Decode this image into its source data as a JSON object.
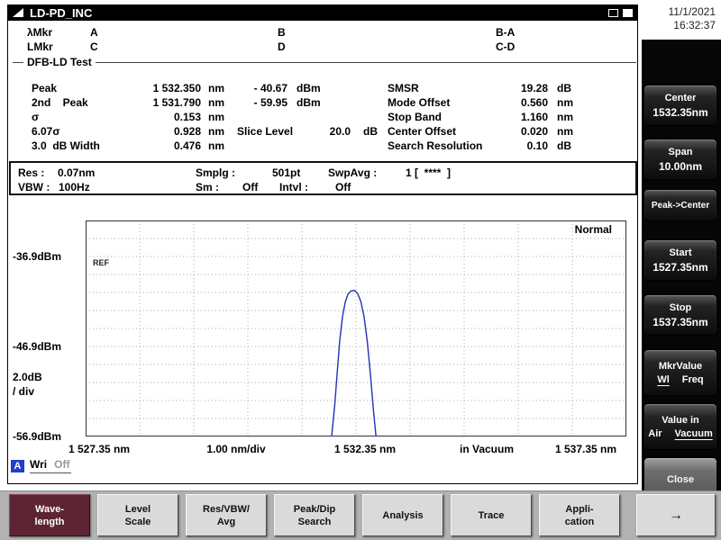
{
  "window": {
    "title": "LD-PD_INC"
  },
  "icons": {
    "app_logo_icon": "right-triangle",
    "window_restore_icon": "outlined-square",
    "window_maximize_icon": "filled-square",
    "more_arrow_icon": "→"
  },
  "clock": {
    "date": "11/1/2021",
    "time": "16:32:37"
  },
  "markers": {
    "row1": {
      "name": "λMkr",
      "c1": "A",
      "c2": "B",
      "c3": "B-A"
    },
    "row2": {
      "name": "LMkr",
      "c1": "C",
      "c2": "D",
      "c3": "C-D"
    }
  },
  "analysis": {
    "title": "DFB-LD Test",
    "left_rows": [
      {
        "label": "Peak",
        "num": "1 532.350",
        "unit": "nm",
        "level_num": "- 40.67",
        "level_unit": "dBm"
      },
      {
        "label": "2nd    Peak",
        "num": "1 531.790",
        "unit": "nm",
        "level_num": "- 59.95",
        "level_unit": "dBm"
      },
      {
        "label": "σ",
        "num": "0.153",
        "unit": "nm"
      },
      {
        "label": "6.07σ",
        "num": "0.928",
        "unit": "nm",
        "extra_label": "Slice Level",
        "extra_num": "20.0",
        "extra_unit": "dB"
      },
      {
        "label": "3.0  dB Width",
        "num": "0.476",
        "unit": "nm"
      }
    ],
    "right_rows": [
      {
        "label": "SMSR",
        "num": "19.28",
        "unit": "dB"
      },
      {
        "label": "Mode Offset",
        "num": "0.560",
        "unit": "nm"
      },
      {
        "label": "Stop Band",
        "num": "1.160",
        "unit": "nm"
      },
      {
        "label": "Center Offset",
        "num": "0.020",
        "unit": "nm"
      },
      {
        "label": "Search Resolution",
        "num": "0.10",
        "unit": "dB"
      }
    ]
  },
  "sweep": {
    "res_label": "Res :",
    "res_value": "0.07nm",
    "smplg_label": "Smplg :",
    "smplg_value": "501pt",
    "swpavg_label": "SwpAvg :",
    "swpavg_value": "1 [  ****  ]",
    "vbw_label": "VBW :",
    "vbw_value": "100Hz",
    "sm_label": "Sm :",
    "sm_value": "Off",
    "intvl_label": "Intvl :",
    "intvl_value": "Off"
  },
  "chart_data": {
    "type": "line",
    "mode_label": "Normal",
    "ref_label": "REF",
    "x_start_nm": 1527.35,
    "x_stop_nm": 1537.35,
    "x_div_nm": 1.0,
    "x_divisions": 10,
    "y_ref_dbm": -36.9,
    "y_db_per_div": 2.0,
    "y_divisions": 12,
    "ref_div_from_top": 2,
    "x_tick_labels": {
      "left": "1 527.35 nm",
      "div": "1.00 nm/div",
      "center": "1 532.35 nm",
      "medium": "in Vacuum",
      "right": "1 537.35 nm"
    },
    "y_tick_labels": {
      "ref": "-36.9dBm",
      "mid": "-46.9dBm",
      "bottom": "-56.9dBm",
      "scale_line1": "2.0dB",
      "scale_line2": "/ div"
    },
    "trace_color": "#2431b6",
    "series": [
      {
        "name": "Trace A",
        "points_nm_dbm": [
          [
            1531.9,
            -56.9
          ],
          [
            1531.96,
            -53.2
          ],
          [
            1532.0,
            -50.0
          ],
          [
            1532.05,
            -46.2
          ],
          [
            1532.1,
            -43.6
          ],
          [
            1532.15,
            -42.0
          ],
          [
            1532.2,
            -41.1
          ],
          [
            1532.26,
            -40.72
          ],
          [
            1532.32,
            -40.67
          ],
          [
            1532.38,
            -41.0
          ],
          [
            1532.44,
            -41.9
          ],
          [
            1532.5,
            -43.6
          ],
          [
            1532.56,
            -46.4
          ],
          [
            1532.62,
            -50.2
          ],
          [
            1532.67,
            -53.8
          ],
          [
            1532.72,
            -56.9
          ]
        ]
      }
    ]
  },
  "trace_status": {
    "trace_letter": "A",
    "mode": "Wri",
    "off": "Off"
  },
  "softkeys": [
    {
      "label": "Center",
      "value": "1532.35nm"
    },
    {
      "label": "Span",
      "value": "10.00nm"
    },
    {
      "label": "Peak->Center",
      "value": ""
    },
    {
      "label": "Start",
      "value": "1527.35nm"
    },
    {
      "label": "Stop",
      "value": "1537.35nm"
    },
    {
      "label": "MkrValue",
      "options": [
        "Wl",
        "Freq"
      ],
      "selected_option": 0
    },
    {
      "label": "Value in",
      "options": [
        "Air",
        "Vacuum"
      ],
      "selected_option": 1
    },
    {
      "label": "Close",
      "value": "",
      "dimmed": true
    }
  ],
  "fnkeys": [
    {
      "line1": "Wave-",
      "line2": "length",
      "selected": true
    },
    {
      "line1": "Level",
      "line2": "Scale"
    },
    {
      "line1": "Res/VBW/",
      "line2": "Avg"
    },
    {
      "line1": "Peak/Dip",
      "line2": "Search"
    },
    {
      "line1": "Analysis",
      "line2": ""
    },
    {
      "line1": "Trace",
      "line2": ""
    },
    {
      "line1": "Appli-",
      "line2": "cation"
    },
    {
      "line1": "→",
      "line2": "",
      "arrow": true
    }
  ]
}
